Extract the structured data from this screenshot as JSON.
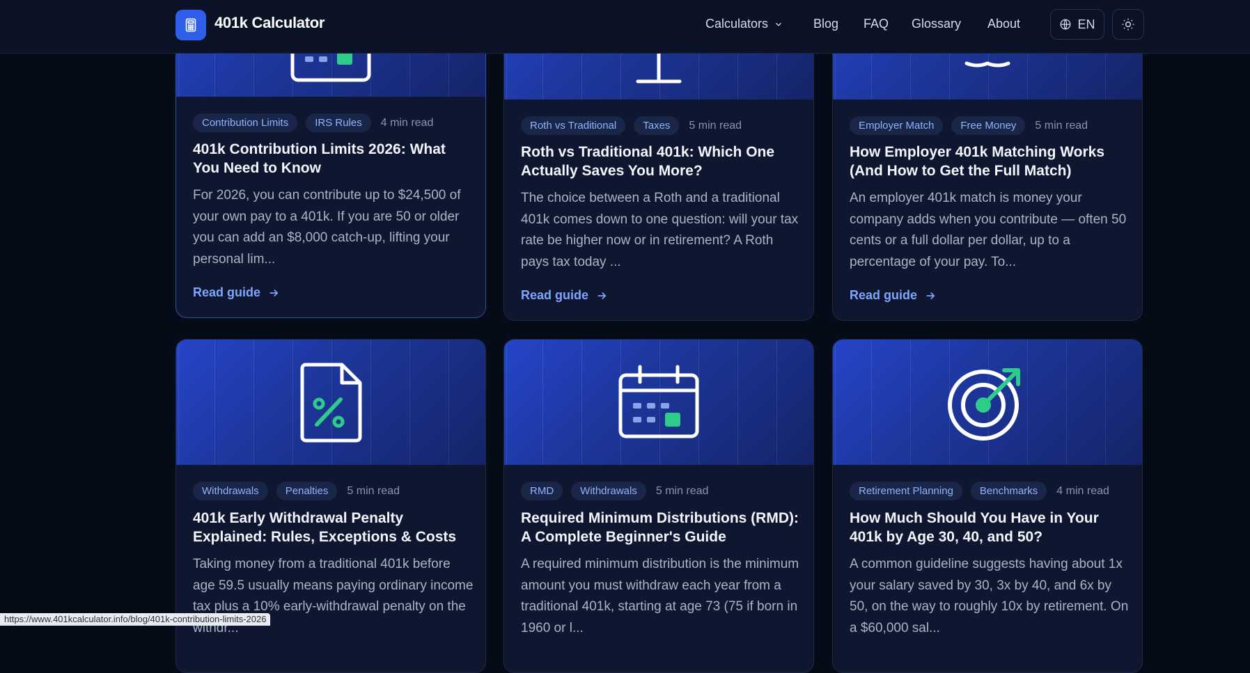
{
  "header": {
    "brand": "401k Calculator",
    "nav": {
      "calculators": "Calculators",
      "blog": "Blog",
      "faq": "FAQ",
      "glossary": "Glossary",
      "about": "About"
    },
    "language": "EN",
    "icons": {
      "logo": "calculator-icon",
      "lang": "globe-icon",
      "theme": "sun-icon",
      "dropdown": "chevron-down-icon"
    }
  },
  "cards": [
    {
      "tags": [
        "Contribution Limits",
        "IRS Rules"
      ],
      "read_time": "4 min read",
      "title": "401k Contribution Limits 2026: What You Need to Know",
      "excerpt": "For 2026, you can contribute up to $24,500 of your own pay to a 401k. If you are 50 or older you can add an $8,000 catch-up, lifting your personal lim...",
      "link": "Read guide",
      "icon": "calendar-icon"
    },
    {
      "tags": [
        "Roth vs Traditional",
        "Taxes"
      ],
      "read_time": "5 min read",
      "title": "Roth vs Traditional 401k: Which One Actually Saves You More?",
      "excerpt": "The choice between a Roth and a traditional 401k comes down to one question: will your tax rate be higher now or in retirement? A Roth pays tax today ...",
      "link": "Read guide",
      "icon": "scale-icon"
    },
    {
      "tags": [
        "Employer Match",
        "Free Money"
      ],
      "read_time": "5 min read",
      "title": "How Employer 401k Matching Works (And How to Get the Full Match)",
      "excerpt": "An employer 401k match is money your company adds when you contribute — often 50 cents or a full dollar per dollar, up to a percentage of your pay. To...",
      "link": "Read guide",
      "icon": "handshake-icon"
    },
    {
      "tags": [
        "Withdrawals",
        "Penalties"
      ],
      "read_time": "5 min read",
      "title": "401k Early Withdrawal Penalty Explained: Rules, Exceptions & Costs",
      "excerpt": "Taking money from a traditional 401k before age 59.5 usually means paying ordinary income tax plus a 10% early-withdrawal penalty on the withdr...",
      "link": "Read guide",
      "icon": "percent-document-icon"
    },
    {
      "tags": [
        "RMD",
        "Withdrawals"
      ],
      "read_time": "5 min read",
      "title": "Required Minimum Distributions (RMD): A Complete Beginner's Guide",
      "excerpt": "A required minimum distribution is the minimum amount you must withdraw each year from a traditional 401k, starting at age 73 (75 if born in 1960 or l...",
      "link": "Read guide",
      "icon": "calendar-icon"
    },
    {
      "tags": [
        "Retirement Planning",
        "Benchmarks"
      ],
      "read_time": "4 min read",
      "title": "How Much Should You Have in Your 401k by Age 30, 40, and 50?",
      "excerpt": "A common guideline suggests having about 1x your salary saved by 30, 3x by 40, and 6x by 50, on the way to roughly 10x by retirement. On a $60,000 sal...",
      "link": "Read guide",
      "icon": "target-icon"
    }
  ],
  "status_url": "https://www.401kcalculator.info/blog/401k-contribution-limits-2026",
  "colors": {
    "accent": "#2f5fe8",
    "link": "#7ea6ff",
    "green": "#2ecc8a",
    "background": "#060b18"
  }
}
